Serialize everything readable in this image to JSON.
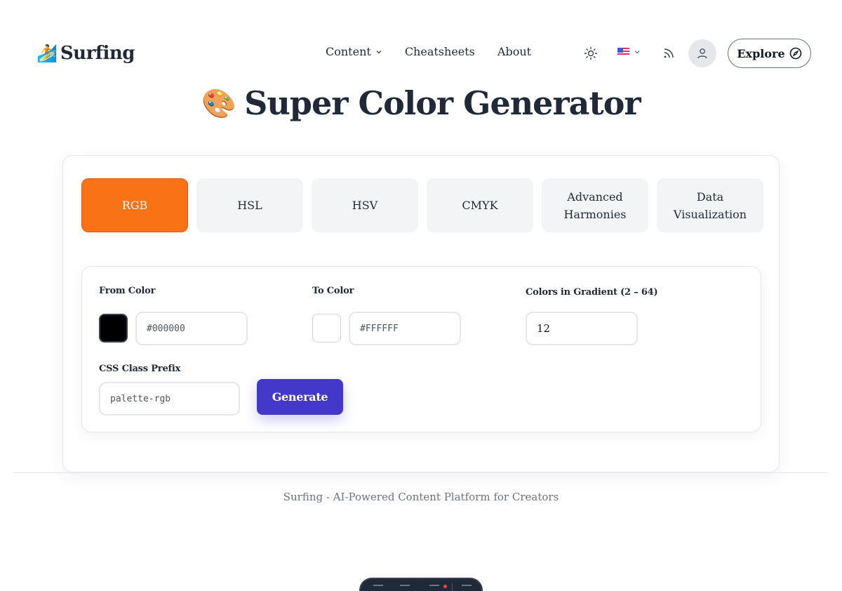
{
  "header": {
    "logo_emoji": "🏄",
    "logo_text": "Surfing",
    "nav": [
      {
        "label": "Content",
        "has_dropdown": true
      },
      {
        "label": "Cheatsheets"
      },
      {
        "label": "About"
      }
    ],
    "explore_label": "Explore",
    "icons": [
      "sun-icon",
      "us-flag-icon",
      "chevron-down-icon",
      "rss-icon",
      "user-icon",
      "compass-icon"
    ]
  },
  "page": {
    "title_emoji": "🎨",
    "title": "Super Color Generator"
  },
  "tabs": [
    {
      "label": "RGB",
      "active": true
    },
    {
      "label": "HSL",
      "active": false
    },
    {
      "label": "HSV",
      "active": false
    },
    {
      "label": "CMYK",
      "active": false
    },
    {
      "label": "Advanced Harmonies",
      "active": false
    },
    {
      "label": "Data Visualization",
      "active": false
    }
  ],
  "form": {
    "from_color_label": "From Color",
    "from_color_value": "#000000",
    "to_color_label": "To Color",
    "to_color_value": "#FFFFFF",
    "gradient_label": "Colors in Gradient (2 – 64)",
    "gradient_value": "12",
    "prefix_label": "CSS Class Prefix",
    "prefix_value": "palette-rgb",
    "generate_label": "Generate"
  },
  "footer": {
    "text": "Surfing - AI-Powered Content Platform for Creators"
  },
  "colors": {
    "accent_active_tab": "#f97316",
    "primary_button": "#4338ca",
    "from_swatch": "#000000",
    "to_swatch": "#ffffff"
  }
}
